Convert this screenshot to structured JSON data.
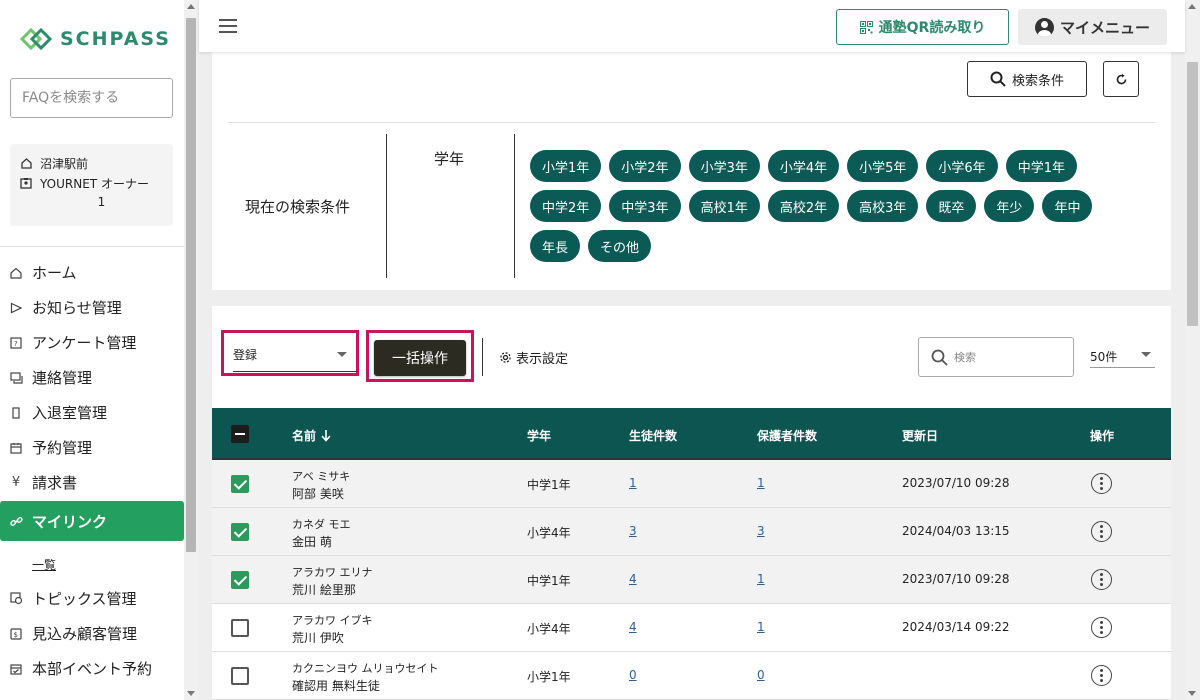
{
  "brand": {
    "name": "SCHPASS",
    "color": "#2d8a6a"
  },
  "sidebar": {
    "faq_placeholder": "FAQを検索する",
    "org": {
      "school": "沼津駅前",
      "owner": "YOURNET オーナー",
      "number": "1"
    },
    "nav": [
      {
        "label": "ホーム",
        "icon": "home-icon"
      },
      {
        "label": "お知らせ管理",
        "icon": "send-icon"
      },
      {
        "label": "アンケート管理",
        "icon": "survey-icon"
      },
      {
        "label": "連絡管理",
        "icon": "chat-icon"
      },
      {
        "label": "入退室管理",
        "icon": "door-icon"
      },
      {
        "label": "予約管理",
        "icon": "calendar-icon"
      },
      {
        "label": "請求書",
        "icon": "yen-icon"
      },
      {
        "label": "マイリンク",
        "icon": "link-icon",
        "active": true
      },
      {
        "label": "トピックス管理",
        "icon": "topics-icon"
      },
      {
        "label": "見込み顧客管理",
        "icon": "prospect-icon"
      },
      {
        "label": "本部イベント予約",
        "icon": "event-calendar-icon"
      }
    ],
    "sub_item": "一覧"
  },
  "header": {
    "qr_button": "通塾QR読み取り",
    "my_menu": "マイメニュー"
  },
  "filter": {
    "search_conditions_button": "検索条件",
    "current_conditions_label": "現在の検索条件",
    "grade_label": "学年",
    "chips": [
      "小学1年",
      "小学2年",
      "小学3年",
      "小学4年",
      "小学5年",
      "小学6年",
      "中学1年",
      "中学2年",
      "中学3年",
      "高校1年",
      "高校2年",
      "高校3年",
      "既卒",
      "年少",
      "年中",
      "年長",
      "その他"
    ]
  },
  "toolbar": {
    "register_select": "登録",
    "bulk_button": "一括操作",
    "display_settings": "表示設定",
    "search_placeholder": "検索",
    "per_page": "50件"
  },
  "table": {
    "headers": {
      "name": "名前",
      "grade": "学年",
      "students": "生徒件数",
      "guardians": "保護者件数",
      "updated": "更新日",
      "actions": "操作"
    },
    "rows": [
      {
        "checked": true,
        "kana": "アベ ミサキ",
        "name": "阿部 美咲",
        "grade": "中学1年",
        "students": "1",
        "guardians": "1",
        "updated": "2023/07/10 09:28"
      },
      {
        "checked": true,
        "kana": "カネダ モエ",
        "name": "金田 萌",
        "grade": "小学4年",
        "students": "3",
        "guardians": "3",
        "updated": "2024/04/03 13:15"
      },
      {
        "checked": true,
        "kana": "アラカワ エリナ",
        "name": "荒川 絵里那",
        "grade": "中学1年",
        "students": "4",
        "guardians": "1",
        "updated": "2023/07/10 09:28"
      },
      {
        "checked": false,
        "kana": "アラカワ イブキ",
        "name": "荒川 伊吹",
        "grade": "小学4年",
        "students": "4",
        "guardians": "1",
        "updated": "2024/03/14 09:22"
      },
      {
        "checked": false,
        "kana": "カクニンヨウ ムリョウセイト",
        "name": "確認用 無料生徒",
        "grade": "小学1年",
        "students": "0",
        "guardians": "0",
        "updated": ""
      }
    ]
  }
}
